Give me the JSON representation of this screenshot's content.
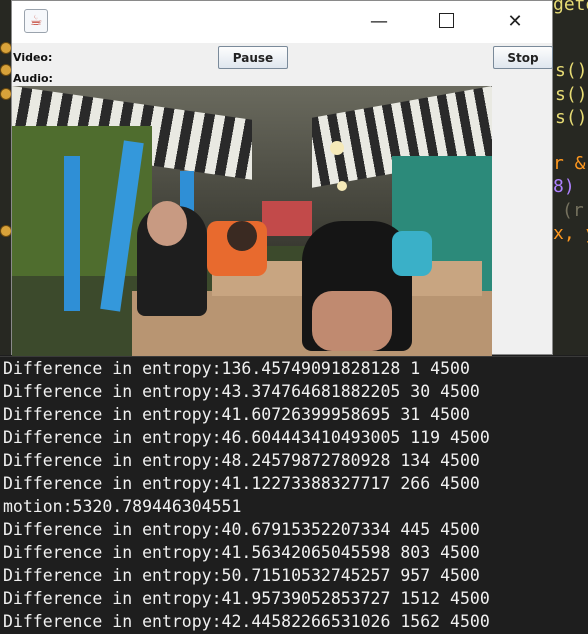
{
  "editor": {
    "fragments": [
      "gete",
      "s()",
      "s()",
      "s()",
      "r &",
      "8)",
      "(r",
      "x, y"
    ]
  },
  "window": {
    "video_label": "Video:",
    "audio_label": "Audio:",
    "pause_label": "Pause",
    "stop_label": "Stop",
    "controls": {
      "minimize": "—",
      "close": "✕"
    },
    "icon": "java-coffee-icon"
  },
  "console": {
    "lines": [
      "Difference in entropy:136.45749091828128 1 4500",
      "Difference in entropy:43.374764681882205 30 4500",
      "Difference in entropy:41.60726399958695 31 4500",
      "Difference in entropy:46.604443410493005 119 4500",
      "Difference in entropy:48.24579872780928 134 4500",
      "Difference in entropy:41.12273388327717 266 4500",
      "motion:5320.789446304551",
      "Difference in entropy:40.67915352207334 445 4500",
      "Difference in entropy:41.56342065045598 803 4500",
      "Difference in entropy:50.71510532745257 957 4500",
      "Difference in entropy:41.95739052853727 1512 4500",
      "Difference in entropy:42.44582266531026 1562 4500"
    ]
  },
  "colors": {
    "editor_bg": "#272822",
    "code_yellow": "#e6db74",
    "code_white": "#f8f8f2",
    "code_orange": "#fd971f",
    "console_bg": "#1e1e1e",
    "console_text": "#f0f0f0"
  }
}
